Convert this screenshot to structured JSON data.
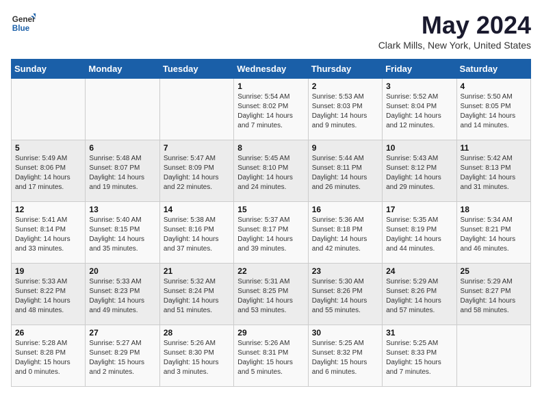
{
  "logo": {
    "general": "General",
    "blue": "Blue"
  },
  "title": "May 2024",
  "location": "Clark Mills, New York, United States",
  "days_header": [
    "Sunday",
    "Monday",
    "Tuesday",
    "Wednesday",
    "Thursday",
    "Friday",
    "Saturday"
  ],
  "weeks": [
    [
      {
        "day": "",
        "info": ""
      },
      {
        "day": "",
        "info": ""
      },
      {
        "day": "",
        "info": ""
      },
      {
        "day": "1",
        "info": "Sunrise: 5:54 AM\nSunset: 8:02 PM\nDaylight: 14 hours\nand 7 minutes."
      },
      {
        "day": "2",
        "info": "Sunrise: 5:53 AM\nSunset: 8:03 PM\nDaylight: 14 hours\nand 9 minutes."
      },
      {
        "day": "3",
        "info": "Sunrise: 5:52 AM\nSunset: 8:04 PM\nDaylight: 14 hours\nand 12 minutes."
      },
      {
        "day": "4",
        "info": "Sunrise: 5:50 AM\nSunset: 8:05 PM\nDaylight: 14 hours\nand 14 minutes."
      }
    ],
    [
      {
        "day": "5",
        "info": "Sunrise: 5:49 AM\nSunset: 8:06 PM\nDaylight: 14 hours\nand 17 minutes."
      },
      {
        "day": "6",
        "info": "Sunrise: 5:48 AM\nSunset: 8:07 PM\nDaylight: 14 hours\nand 19 minutes."
      },
      {
        "day": "7",
        "info": "Sunrise: 5:47 AM\nSunset: 8:09 PM\nDaylight: 14 hours\nand 22 minutes."
      },
      {
        "day": "8",
        "info": "Sunrise: 5:45 AM\nSunset: 8:10 PM\nDaylight: 14 hours\nand 24 minutes."
      },
      {
        "day": "9",
        "info": "Sunrise: 5:44 AM\nSunset: 8:11 PM\nDaylight: 14 hours\nand 26 minutes."
      },
      {
        "day": "10",
        "info": "Sunrise: 5:43 AM\nSunset: 8:12 PM\nDaylight: 14 hours\nand 29 minutes."
      },
      {
        "day": "11",
        "info": "Sunrise: 5:42 AM\nSunset: 8:13 PM\nDaylight: 14 hours\nand 31 minutes."
      }
    ],
    [
      {
        "day": "12",
        "info": "Sunrise: 5:41 AM\nSunset: 8:14 PM\nDaylight: 14 hours\nand 33 minutes."
      },
      {
        "day": "13",
        "info": "Sunrise: 5:40 AM\nSunset: 8:15 PM\nDaylight: 14 hours\nand 35 minutes."
      },
      {
        "day": "14",
        "info": "Sunrise: 5:38 AM\nSunset: 8:16 PM\nDaylight: 14 hours\nand 37 minutes."
      },
      {
        "day": "15",
        "info": "Sunrise: 5:37 AM\nSunset: 8:17 PM\nDaylight: 14 hours\nand 39 minutes."
      },
      {
        "day": "16",
        "info": "Sunrise: 5:36 AM\nSunset: 8:18 PM\nDaylight: 14 hours\nand 42 minutes."
      },
      {
        "day": "17",
        "info": "Sunrise: 5:35 AM\nSunset: 8:19 PM\nDaylight: 14 hours\nand 44 minutes."
      },
      {
        "day": "18",
        "info": "Sunrise: 5:34 AM\nSunset: 8:21 PM\nDaylight: 14 hours\nand 46 minutes."
      }
    ],
    [
      {
        "day": "19",
        "info": "Sunrise: 5:33 AM\nSunset: 8:22 PM\nDaylight: 14 hours\nand 48 minutes."
      },
      {
        "day": "20",
        "info": "Sunrise: 5:33 AM\nSunset: 8:23 PM\nDaylight: 14 hours\nand 49 minutes."
      },
      {
        "day": "21",
        "info": "Sunrise: 5:32 AM\nSunset: 8:24 PM\nDaylight: 14 hours\nand 51 minutes."
      },
      {
        "day": "22",
        "info": "Sunrise: 5:31 AM\nSunset: 8:25 PM\nDaylight: 14 hours\nand 53 minutes."
      },
      {
        "day": "23",
        "info": "Sunrise: 5:30 AM\nSunset: 8:26 PM\nDaylight: 14 hours\nand 55 minutes."
      },
      {
        "day": "24",
        "info": "Sunrise: 5:29 AM\nSunset: 8:26 PM\nDaylight: 14 hours\nand 57 minutes."
      },
      {
        "day": "25",
        "info": "Sunrise: 5:29 AM\nSunset: 8:27 PM\nDaylight: 14 hours\nand 58 minutes."
      }
    ],
    [
      {
        "day": "26",
        "info": "Sunrise: 5:28 AM\nSunset: 8:28 PM\nDaylight: 15 hours\nand 0 minutes."
      },
      {
        "day": "27",
        "info": "Sunrise: 5:27 AM\nSunset: 8:29 PM\nDaylight: 15 hours\nand 2 minutes."
      },
      {
        "day": "28",
        "info": "Sunrise: 5:26 AM\nSunset: 8:30 PM\nDaylight: 15 hours\nand 3 minutes."
      },
      {
        "day": "29",
        "info": "Sunrise: 5:26 AM\nSunset: 8:31 PM\nDaylight: 15 hours\nand 5 minutes."
      },
      {
        "day": "30",
        "info": "Sunrise: 5:25 AM\nSunset: 8:32 PM\nDaylight: 15 hours\nand 6 minutes."
      },
      {
        "day": "31",
        "info": "Sunrise: 5:25 AM\nSunset: 8:33 PM\nDaylight: 15 hours\nand 7 minutes."
      },
      {
        "day": "",
        "info": ""
      }
    ]
  ]
}
